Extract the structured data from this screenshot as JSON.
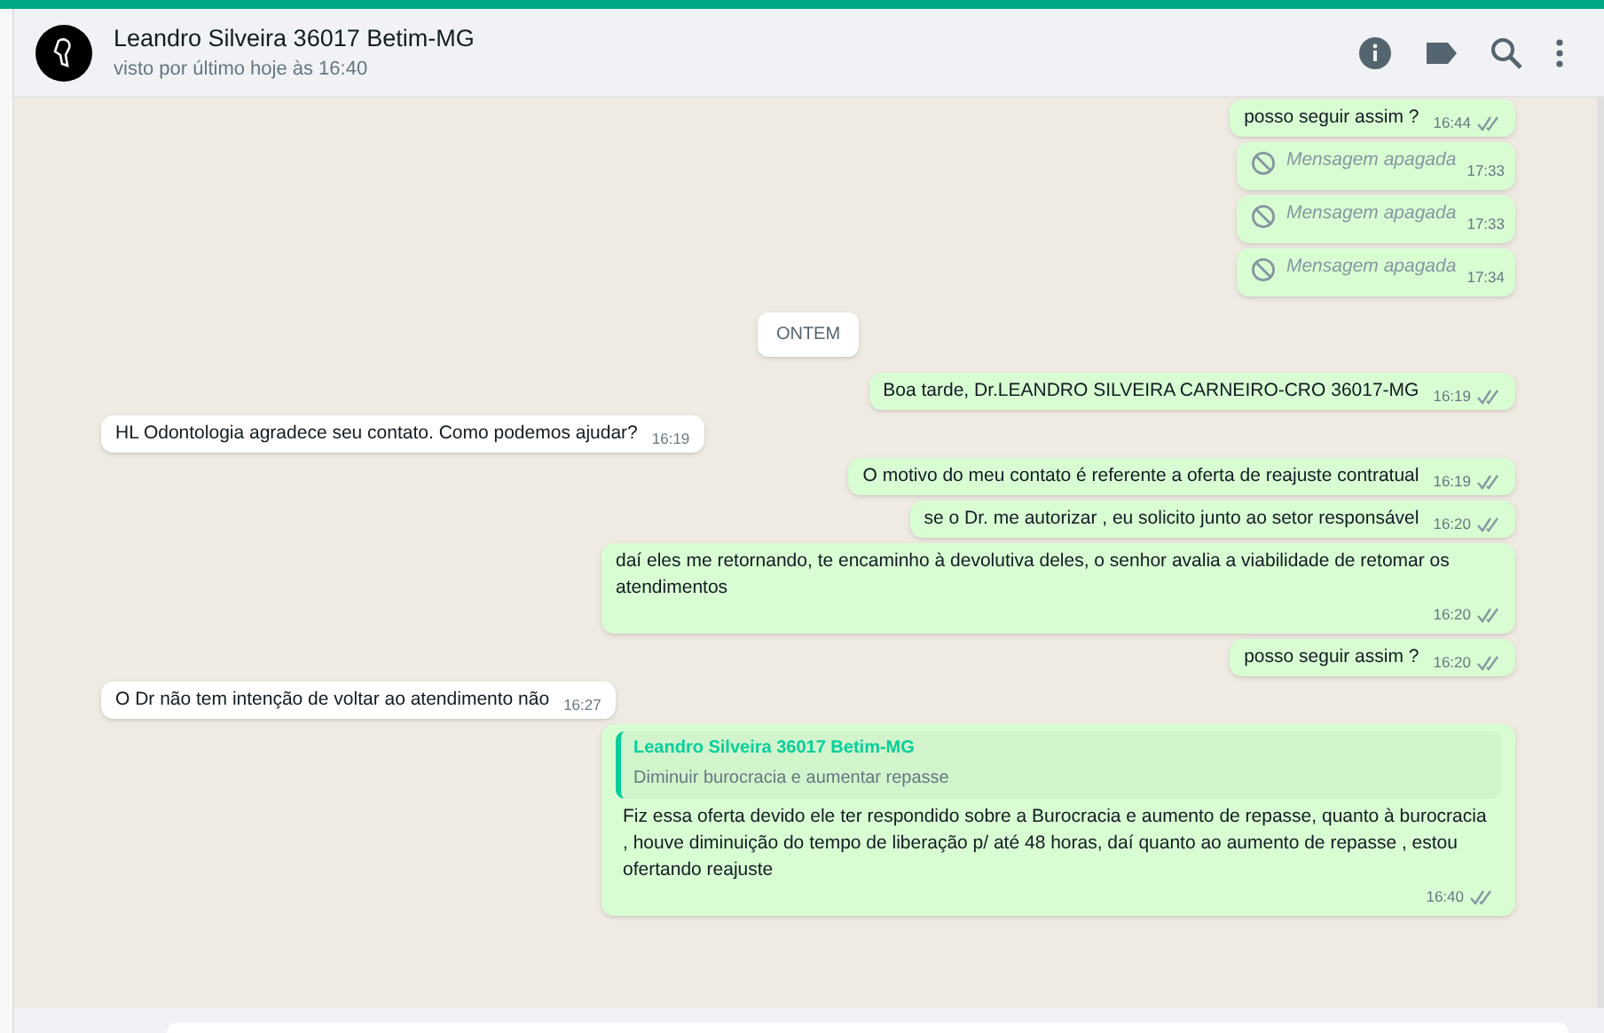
{
  "header": {
    "name": "Leandro Silveira 36017 Betim-MG",
    "status": "visto por último hoje às 16:40"
  },
  "messages": [
    {
      "kind": "text",
      "outgoing": true,
      "text": "posso seguir assim ?",
      "time": "16:44",
      "read": true
    },
    {
      "kind": "deleted",
      "outgoing": true,
      "text": "Mensagem apagada",
      "time": "17:33"
    },
    {
      "kind": "deleted",
      "outgoing": true,
      "text": "Mensagem apagada",
      "time": "17:33"
    },
    {
      "kind": "deleted",
      "outgoing": true,
      "text": "Mensagem apagada",
      "time": "17:34"
    },
    {
      "kind": "date",
      "text": "ONTEM"
    },
    {
      "kind": "text",
      "outgoing": true,
      "text": "Boa tarde, Dr.LEANDRO SILVEIRA CARNEIRO-CRO 36017-MG",
      "time": "16:19",
      "read": true
    },
    {
      "kind": "text",
      "outgoing": false,
      "text": "HL Odontologia agradece seu contato. Como podemos ajudar?",
      "time": "16:19",
      "read": false
    },
    {
      "kind": "text",
      "outgoing": true,
      "text": "O motivo do meu contato é referente a oferta de reajuste contratual",
      "time": "16:19",
      "read": true
    },
    {
      "kind": "text",
      "outgoing": true,
      "text": "se o Dr. me autorizar , eu solicito junto ao setor responsável",
      "time": "16:20",
      "read": true
    },
    {
      "kind": "text",
      "outgoing": true,
      "text": "daí eles me retornando, te encaminho à devolutiva deles, o senhor avalia a viabilidade de retomar os atendimentos",
      "time": "16:20",
      "read": true
    },
    {
      "kind": "text",
      "outgoing": true,
      "text": "posso seguir assim ?",
      "time": "16:20",
      "read": true
    },
    {
      "kind": "text",
      "outgoing": false,
      "text": "O Dr não tem intenção de voltar ao atendimento não",
      "time": "16:27",
      "read": false
    },
    {
      "kind": "reply",
      "outgoing": true,
      "quote_author": "Leandro Silveira 36017 Betim-MG",
      "quote_text": "Diminuir burocracia e aumentar repasse",
      "text": "Fiz essa oferta devido ele ter respondido sobre a Burocracia e aumento de repasse, quanto à burocracia , houve diminuição do tempo de liberação p/ até 48 horas, daí quanto ao aumento de repasse , estou ofertando reajuste",
      "time": "16:40",
      "read": true
    }
  ]
}
